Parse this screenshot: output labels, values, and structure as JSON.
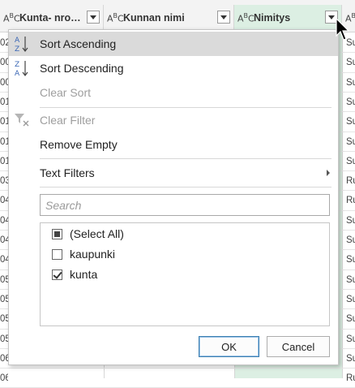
{
  "columns": [
    {
      "type_icon": "ABC",
      "title": "Kunta- nro…"
    },
    {
      "type_icon": "ABC",
      "title": "Kunnan nimi"
    },
    {
      "type_icon": "ABC",
      "title": "Nimitys"
    },
    {
      "type_icon": "AB",
      "title": ""
    }
  ],
  "menu": {
    "sort_ascending": "Sort Ascending",
    "sort_descending": "Sort Descending",
    "clear_sort": "Clear Sort",
    "clear_filter": "Clear Filter",
    "remove_empty": "Remove Empty",
    "text_filters": "Text Filters"
  },
  "search": {
    "placeholder": "Search"
  },
  "filter_list": [
    {
      "label": "(Select All)",
      "state": "partial"
    },
    {
      "label": "kaupunki",
      "state": "unchecked"
    },
    {
      "label": "kunta",
      "state": "checked"
    }
  ],
  "buttons": {
    "ok": "OK",
    "cancel": "Cancel"
  },
  "background_rows": {
    "left": [
      "02",
      "00",
      "00",
      "01",
      "01",
      "01",
      "01",
      "03",
      "04",
      "04",
      "04",
      "04",
      "05",
      "05",
      "05",
      "05",
      "06",
      "06"
    ],
    "right": [
      "Su",
      "Su",
      "Su",
      "Su",
      "Su",
      "Su",
      "Su",
      "Ru",
      "Ru",
      "Su",
      "Su",
      "Su",
      "Su",
      "Su",
      "Su",
      "Su",
      "Su",
      "Ru"
    ]
  },
  "colors": {
    "accent_column": "#dcefe3",
    "hover_item": "#dadada",
    "ok_border": "#3c7fb1"
  }
}
